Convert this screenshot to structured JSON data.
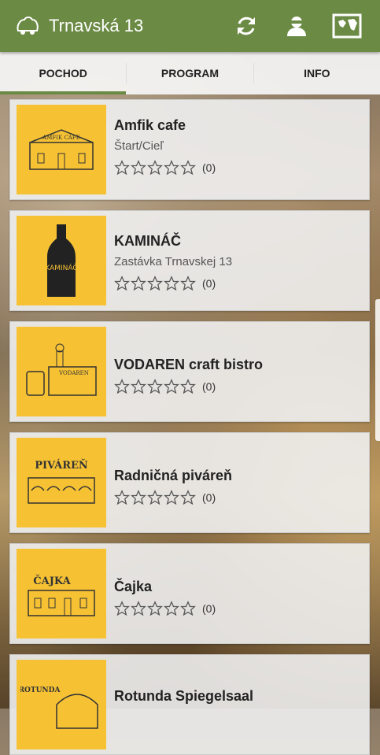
{
  "app": {
    "title": "Trnavská 13"
  },
  "toolbar": {
    "refresh_icon": "refresh-icon",
    "user_icon": "user-icon",
    "map_icon": "map-icon"
  },
  "tabs": [
    {
      "label": "POCHOD",
      "active": true
    },
    {
      "label": "PROGRAM",
      "active": false
    },
    {
      "label": "INFO",
      "active": false
    }
  ],
  "colors": {
    "appbar": "#6b8a44",
    "thumb": "#f6c234"
  },
  "items": [
    {
      "name": "Amfik cafe",
      "subtitle": "Štart/Cieľ",
      "rating_count": "(0)",
      "rating": 0,
      "thumb_text": "AMFIK CAFE"
    },
    {
      "name": "KAMINÁČ",
      "subtitle": "Zastávka Trnavskej 13",
      "rating_count": "(0)",
      "rating": 0,
      "thumb_text": "KAMINÁČ"
    },
    {
      "name": "VODAREN craft bistro",
      "subtitle": "",
      "rating_count": "(0)",
      "rating": 0,
      "thumb_text": "VODAREN"
    },
    {
      "name": "Radničná piváreň",
      "subtitle": "",
      "rating_count": "(0)",
      "rating": 0,
      "thumb_text": "PIVÁREŇ"
    },
    {
      "name": "Čajka",
      "subtitle": "",
      "rating_count": "(0)",
      "rating": 0,
      "thumb_text": "ČAJKA"
    },
    {
      "name": "Rotunda Spiegelsaal",
      "subtitle": "",
      "rating_count": "",
      "rating": 0,
      "thumb_text": "ROTUNDA"
    }
  ]
}
